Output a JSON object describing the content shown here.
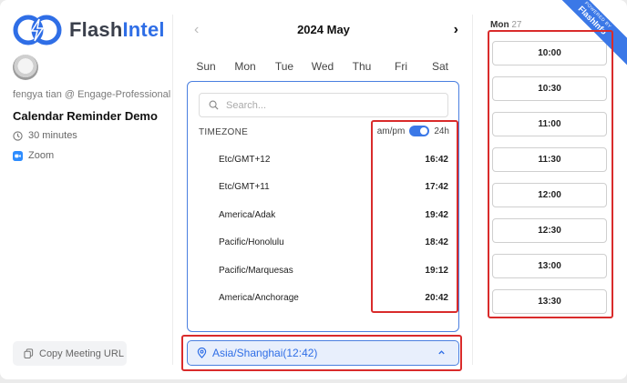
{
  "brand": {
    "name_part1": "Flash",
    "name_part2": "Intel"
  },
  "ribbon": {
    "top_text": "POWERED BY",
    "bottom_text": "FlashInfo"
  },
  "host": {
    "line": "fengya tian @ Engage-Professional"
  },
  "event": {
    "title": "Calendar Reminder Demo",
    "duration": "30 minutes",
    "location": "Zoom"
  },
  "copy_button": {
    "label": "Copy Meeting URL"
  },
  "calendar": {
    "month_title": "2024 May",
    "weekdays": [
      "Sun",
      "Mon",
      "Tue",
      "Wed",
      "Thu",
      "Fri",
      "Sat"
    ]
  },
  "timezone_panel": {
    "search_placeholder": "Search...",
    "label": "TIMEZONE",
    "toggle_left": "am/pm",
    "toggle_right": "24h",
    "toggle_on": true,
    "rows": [
      {
        "name": "Etc/GMT+12",
        "time": "16:42"
      },
      {
        "name": "Etc/GMT+11",
        "time": "17:42"
      },
      {
        "name": "America/Adak",
        "time": "19:42"
      },
      {
        "name": "Pacific/Honolulu",
        "time": "18:42"
      },
      {
        "name": "Pacific/Marquesas",
        "time": "19:12"
      },
      {
        "name": "America/Anchorage",
        "time": "20:42"
      }
    ]
  },
  "selected_timezone": {
    "label": "Asia/Shanghai(12:42)"
  },
  "slots": {
    "day": "Mon",
    "date": "27",
    "times": [
      "10:00",
      "10:30",
      "11:00",
      "11:30",
      "12:00",
      "12:30",
      "13:00",
      "13:30"
    ]
  },
  "colors": {
    "accent": "#2f6ee6",
    "highlight": "#d92b2b"
  }
}
